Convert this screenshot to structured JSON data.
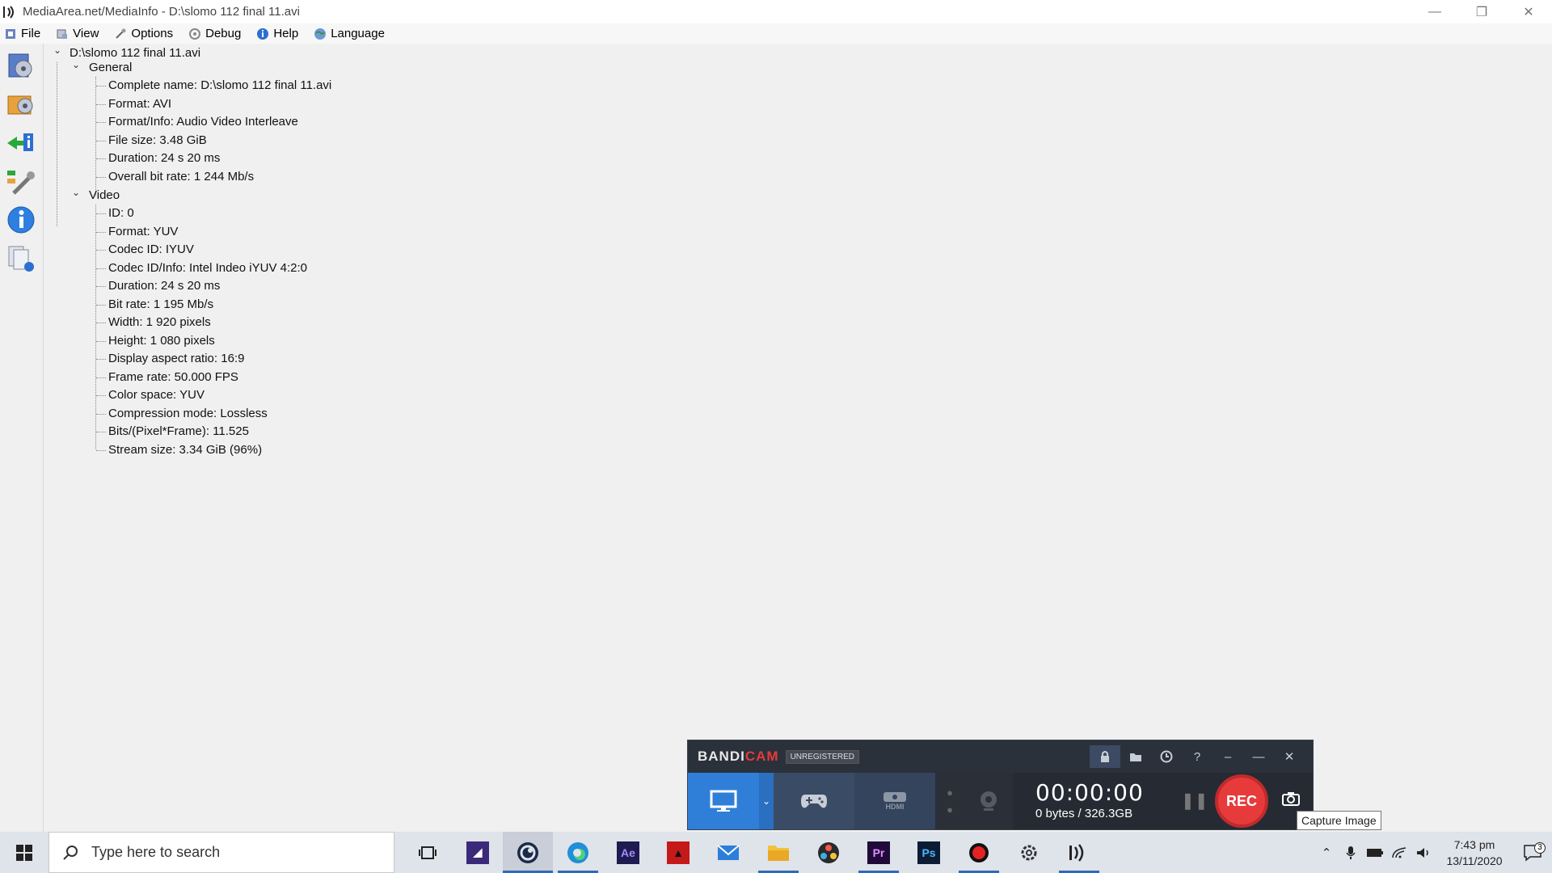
{
  "window": {
    "title": "MediaArea.net/MediaInfo - D:\\slomo 112 final 11.avi"
  },
  "menu": {
    "file": "File",
    "view": "View",
    "options": "Options",
    "debug": "Debug",
    "help": "Help",
    "language": "Language"
  },
  "tree": {
    "root": "D:\\slomo 112 final 11.avi",
    "general": {
      "label": "General",
      "items": [
        "Complete name: D:\\slomo 112 final 11.avi",
        "Format: AVI",
        "Format/Info: Audio Video Interleave",
        "File size: 3.48 GiB",
        "Duration: 24 s 20 ms",
        "Overall bit rate: 1 244 Mb/s"
      ]
    },
    "video": {
      "label": "Video",
      "items": [
        "ID: 0",
        "Format: YUV",
        "Codec ID: IYUV",
        "Codec ID/Info: Intel Indeo iYUV 4:2:0",
        "Duration: 24 s 20 ms",
        "Bit rate: 1 195 Mb/s",
        "Width: 1 920 pixels",
        "Height: 1 080 pixels",
        "Display aspect ratio: 16:9",
        "Frame rate: 50.000 FPS",
        "Color space: YUV",
        "Compression mode: Lossless",
        "Bits/(Pixel*Frame): 11.525",
        "Stream size: 3.34 GiB (96%)"
      ]
    }
  },
  "bandicam": {
    "logo_main": "BANDI",
    "logo_accent": "CAM",
    "unregistered": "UNREGISTERED",
    "timer": "00:00:00",
    "bytes": "0 bytes / 326.3GB",
    "rec_label": "REC",
    "tooltip": "Capture Image",
    "hdmi_label": "HDMI",
    "accent_color": "#e53a3a",
    "screen_mode_color": "#2f7fd8"
  },
  "taskbar": {
    "search_placeholder": "Type here to search",
    "time": "7:43 pm",
    "date": "13/11/2020",
    "notification_count": "3"
  }
}
